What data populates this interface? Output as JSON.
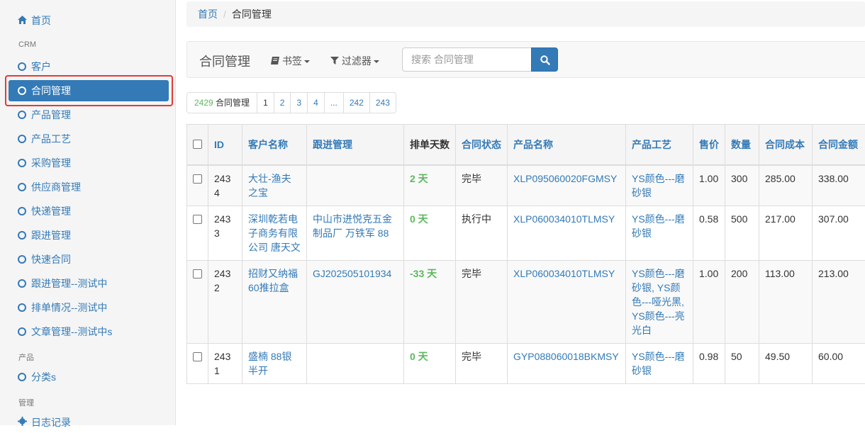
{
  "sidebar": {
    "home": "首页",
    "crm_header": "CRM",
    "crm_items": [
      "客户",
      "合同管理",
      "产品管理",
      "产品工艺",
      "采购管理",
      "供应商管理",
      "快递管理",
      "跟进管理",
      "快速合同",
      "跟进管理--测试中",
      "排单情况--测试中",
      "文章管理--测试中s"
    ],
    "product_header": "产品",
    "product_items": [
      "分类s"
    ],
    "manage_header": "管理",
    "manage_items": [
      "日志记录"
    ],
    "active_item": "合同管理"
  },
  "breadcrumb": {
    "home": "首页",
    "separator": "/",
    "current": "合同管理"
  },
  "toolbar": {
    "brand": "合同管理",
    "bookmarks": "书签",
    "filters": "过滤器",
    "search_placeholder": "搜索 合同管理"
  },
  "pagination": {
    "count": "2429",
    "count_label": "合同管理",
    "pages": [
      "1",
      "2",
      "3",
      "4",
      "...",
      "242",
      "243"
    ],
    "current": "1"
  },
  "table": {
    "headers": [
      "ID",
      "客户名称",
      "跟进管理",
      "排单天数",
      "合同状态",
      "产品名称",
      "产品工艺",
      "售价",
      "数量",
      "合同成本",
      "合同金额"
    ],
    "rows": [
      {
        "id": "2434",
        "customer": "大壮-渔夫之宝",
        "followup": "",
        "days": "2 天",
        "status": "完毕",
        "product": "XLP095060020FGMSY",
        "process": "YS颜色---磨砂银",
        "price": "1.00",
        "qty": "300",
        "cost": "285.00",
        "amount": "338.00"
      },
      {
        "id": "2433",
        "customer": "深圳乾若电子商务有限公司 唐天文",
        "followup": "中山市进悦克五金制品厂 万铁军 88",
        "days": "0 天",
        "status": "执行中",
        "product": "XLP060034010TLMSY",
        "process": "YS颜色---磨砂银",
        "price": "0.58",
        "qty": "500",
        "cost": "217.00",
        "amount": "307.00"
      },
      {
        "id": "2432",
        "customer": "招财又纳福60推拉盒",
        "followup": "GJ202505101934",
        "days": "-33 天",
        "status": "完毕",
        "product": "XLP060034010TLMSY",
        "process": "YS颜色---磨砂银, YS颜色---哑光黑, YS颜色---亮光白",
        "price": "1.00",
        "qty": "200",
        "cost": "113.00",
        "amount": "213.00"
      },
      {
        "id": "2431",
        "customer": "盛楠 88银半开",
        "followup": "",
        "days": "0 天",
        "status": "完毕",
        "product": "GYP088060018BKMSY",
        "process": "YS颜色---磨砂银",
        "price": "0.98",
        "qty": "50",
        "cost": "49.50",
        "amount": "60.00"
      }
    ]
  },
  "icons": {
    "home": "home-icon",
    "cog": "cog-icon",
    "bookmark": "book-icon",
    "filter": "filter-icon",
    "search": "search-icon"
  },
  "colors": {
    "primary": "#337ab7",
    "success": "#5cb85c",
    "highlight_outline": "#e53935"
  }
}
